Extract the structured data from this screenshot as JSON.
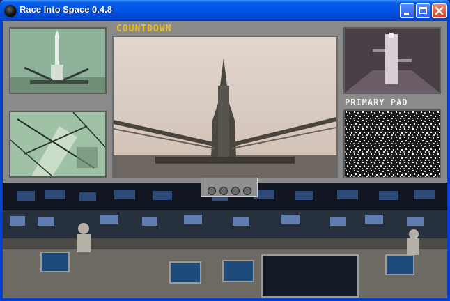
{
  "window": {
    "title": "Race Into Space 0.4.8"
  },
  "labels": {
    "countdown": "COUNTDOWN",
    "primary_pad": "PRIMARY PAD"
  },
  "controls": {
    "caption": "",
    "buttons": [
      "rewind",
      "pause",
      "play",
      "fast-forward"
    ]
  },
  "colors": {
    "countdown_label": "#e6c21a",
    "pad_label": "#f2f2f2",
    "titlebar": "#0055e5"
  }
}
